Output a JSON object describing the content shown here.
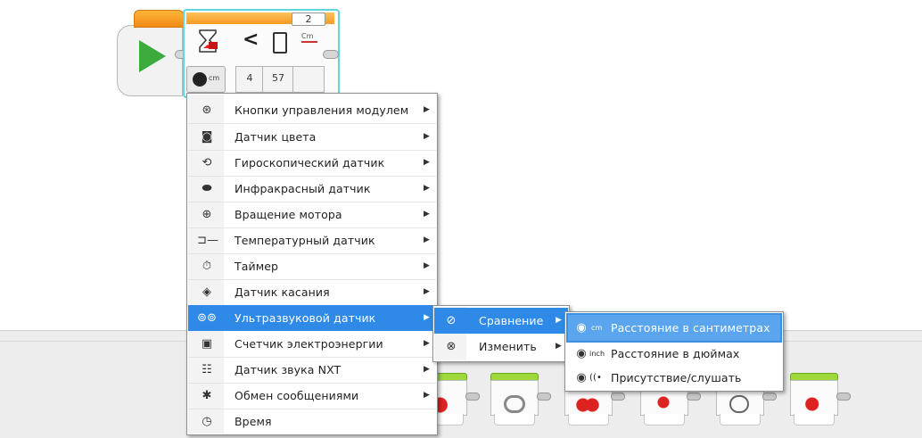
{
  "program": {
    "port_value": "2",
    "field_a": "4",
    "field_b": "57",
    "mode_label": "cm",
    "compare_symbol": "<",
    "unit_label": "Cm"
  },
  "sensor_menu": {
    "items": [
      {
        "label": "Кнопки управления модулем",
        "icon": "brick-buttons-icon",
        "has_submenu": true
      },
      {
        "label": "Датчик цвета",
        "icon": "color-sensor-icon",
        "has_submenu": true
      },
      {
        "label": "Гироскопический датчик",
        "icon": "gyro-sensor-icon",
        "has_submenu": true
      },
      {
        "label": "Инфракрасный датчик",
        "icon": "infrared-sensor-icon",
        "has_submenu": true
      },
      {
        "label": "Вращение мотора",
        "icon": "motor-rotation-icon",
        "has_submenu": true
      },
      {
        "label": "Температурный датчик",
        "icon": "temperature-sensor-icon",
        "has_submenu": true
      },
      {
        "label": "Таймер",
        "icon": "timer-icon",
        "has_submenu": true
      },
      {
        "label": "Датчик касания",
        "icon": "touch-sensor-icon",
        "has_submenu": true
      },
      {
        "label": "Ультразвуковой датчик",
        "icon": "ultrasonic-sensor-icon",
        "has_submenu": true,
        "highlighted": true
      },
      {
        "label": "Счетчик электроэнергии",
        "icon": "energy-meter-icon",
        "has_submenu": true
      },
      {
        "label": "Датчик звука NXT",
        "icon": "sound-sensor-icon",
        "has_submenu": true
      },
      {
        "label": "Обмен сообщениями",
        "icon": "bluetooth-icon",
        "has_submenu": true
      },
      {
        "label": "Время",
        "icon": "time-icon",
        "has_submenu": false
      }
    ]
  },
  "ultrasonic_menu": {
    "items": [
      {
        "label": "Сравнение",
        "icon": "compare-icon",
        "has_submenu": true,
        "highlighted": true
      },
      {
        "label": "Изменить",
        "icon": "change-icon",
        "has_submenu": true
      }
    ]
  },
  "compare_menu": {
    "items": [
      {
        "label": "Расстояние в сантиметрах",
        "icon": "distance-cm-icon",
        "unit": "cm",
        "highlighted": true
      },
      {
        "label": "Расстояние в дюймах",
        "icon": "distance-inch-icon",
        "unit": "inch"
      },
      {
        "label": "Присутствие/слушать",
        "icon": "presence-listen-icon",
        "unit": "((•"
      }
    ]
  },
  "colors": {
    "accent": "#2f89e6",
    "block_header": "#f59a22",
    "start_green": "#3cab3e",
    "palette_green": "#9ed83a",
    "selection_outline": "#5fd6df"
  }
}
